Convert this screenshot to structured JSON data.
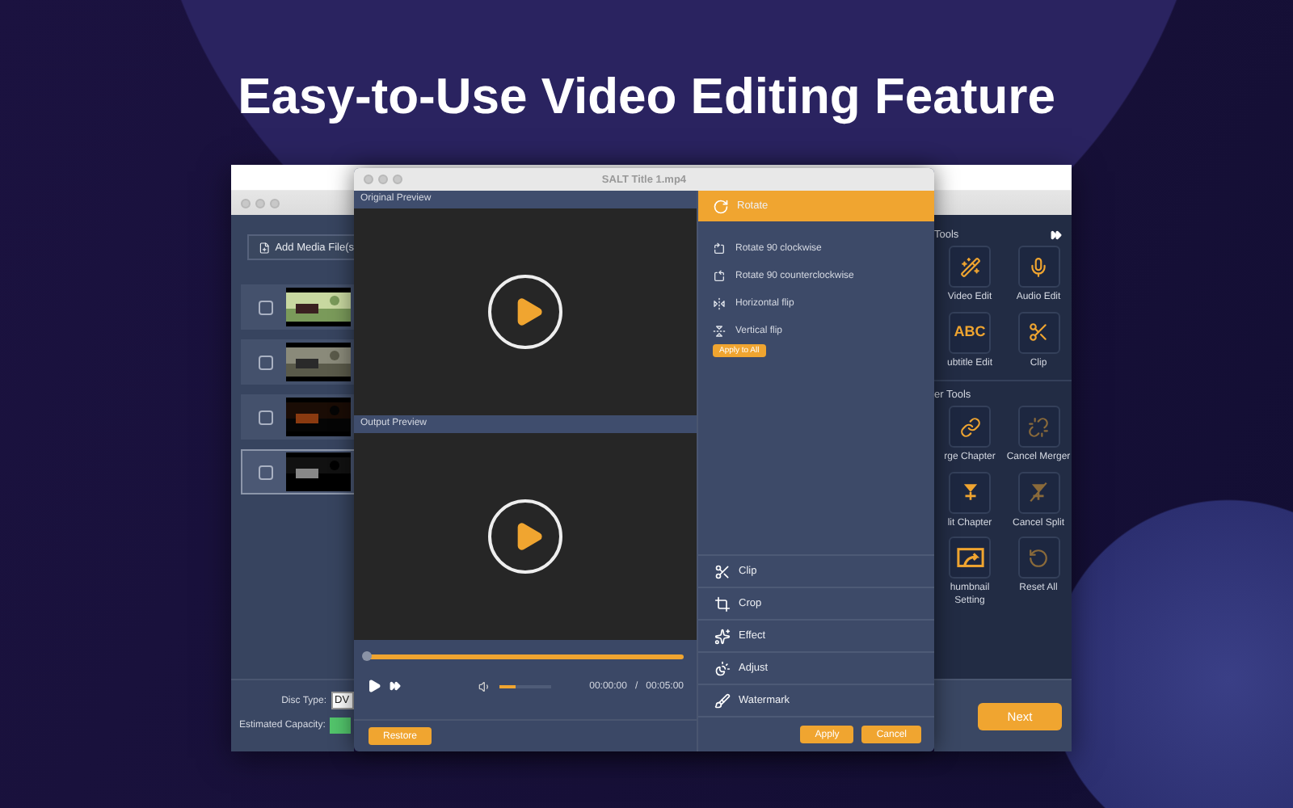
{
  "headline": "Easy-to-Use Video Editing Feature",
  "main_window": {
    "add_button": "Add Media File(s",
    "media": [
      {
        "selected": false,
        "checked": false,
        "kind": "picture"
      },
      {
        "selected": false,
        "checked": false,
        "kind": "picture"
      },
      {
        "selected": false,
        "checked": false,
        "kind": "picture"
      },
      {
        "selected": true,
        "checked": false,
        "kind": "picture"
      }
    ],
    "disc_type_label": "Disc Type:",
    "disc_type_value": "DV",
    "capacity_label": "Estimated Capacity:",
    "tools_heading": "Tools",
    "tools": [
      {
        "label": "Video Edit",
        "kind": "wand",
        "disabled": false
      },
      {
        "label": "Audio Edit",
        "kind": "mic",
        "disabled": false
      },
      {
        "label": "ubtitle Edit",
        "kind": "abc",
        "glyph": "ABC",
        "disabled": false
      },
      {
        "label": "Clip",
        "kind": "scissors",
        "disabled": false
      }
    ],
    "other_tools_heading": "er Tools",
    "other_tools": [
      {
        "label": "rge Chapter",
        "kind": "link",
        "disabled": false
      },
      {
        "label": "Cancel Merger",
        "kind": "unlink",
        "disabled": true
      },
      {
        "label": "lit Chapter",
        "kind": "split",
        "disabled": false
      },
      {
        "label": "Cancel Split",
        "kind": "unsplit",
        "disabled": true
      },
      {
        "label": "humbnail\nSetting",
        "kind": "thumbnail",
        "disabled": false
      },
      {
        "label": "Reset All",
        "kind": "reset",
        "disabled": true
      }
    ],
    "next_button": "Next"
  },
  "dialog": {
    "title": "SALT Title 1.mp4",
    "original_preview": "Original Preview",
    "output_preview": "Output Preview",
    "progress": {
      "level": 0
    },
    "volume": {
      "level": 0.3
    },
    "time_current": "00:00:00",
    "time_separator": "/",
    "time_total": "00:05:00",
    "restore_button": "Restore",
    "sections": [
      {
        "label": "Rotate",
        "kind": "rotate",
        "expanded": true,
        "options": [
          {
            "label": "Rotate 90 clockwise",
            "kind": "cw"
          },
          {
            "label": "Rotate 90 counterclockwise",
            "kind": "ccw"
          },
          {
            "label": "Horizontal flip",
            "kind": "hflip"
          },
          {
            "label": "Vertical flip",
            "kind": "vflip"
          }
        ],
        "apply_all": "Apply to All"
      },
      {
        "label": "Clip",
        "kind": "clip",
        "expanded": false
      },
      {
        "label": "Crop",
        "kind": "crop",
        "expanded": false
      },
      {
        "label": "Effect",
        "kind": "effect",
        "expanded": false
      },
      {
        "label": "Adjust",
        "kind": "adjust",
        "expanded": false
      },
      {
        "label": "Watermark",
        "kind": "watermark",
        "expanded": false
      }
    ],
    "apply_button": "Apply",
    "cancel_button": "Cancel"
  }
}
